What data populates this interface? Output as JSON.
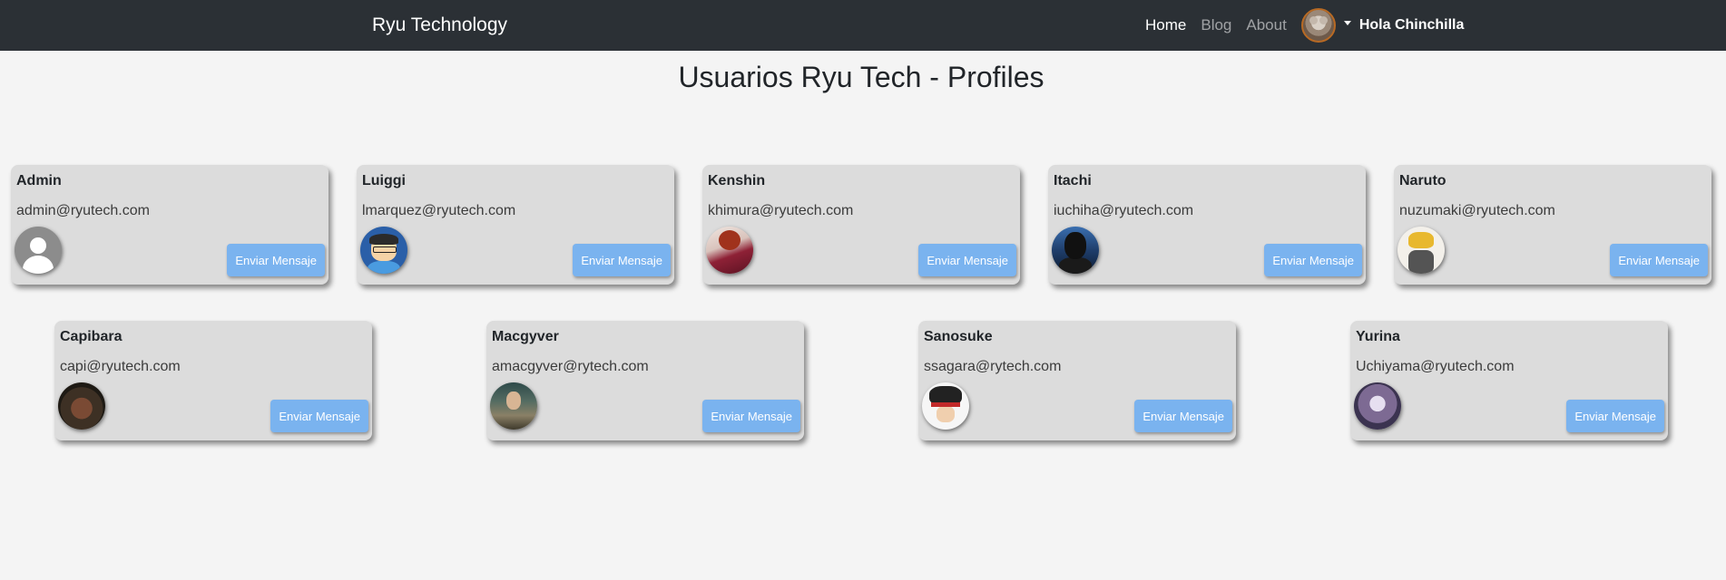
{
  "navbar": {
    "brand": "Ryu Technology",
    "links": [
      {
        "label": "Home",
        "active": true
      },
      {
        "label": "Blog",
        "active": false
      },
      {
        "label": "About",
        "active": false
      }
    ],
    "user_avatar_icon": "hamster-avatar",
    "greeting": "Hola Chinchilla"
  },
  "page": {
    "title": "Usuarios Ryu Tech - Profiles"
  },
  "profiles": [
    {
      "name": "Admin",
      "email": "admin@ryutech.com",
      "avatar": "default-user-avatar",
      "button_label": "Enviar Mensaje"
    },
    {
      "name": "Luiggi",
      "email": "lmarquez@ryutech.com",
      "avatar": "cartoon-boy-avatar",
      "button_label": "Enviar Mensaje"
    },
    {
      "name": "Kenshin",
      "email": "khimura@ryutech.com",
      "avatar": "kenshin-avatar",
      "button_label": "Enviar Mensaje"
    },
    {
      "name": "Itachi",
      "email": "iuchiha@ryutech.com",
      "avatar": "itachi-avatar",
      "button_label": "Enviar Mensaje"
    },
    {
      "name": "Naruto",
      "email": "nuzumaki@ryutech.com",
      "avatar": "naruto-avatar",
      "button_label": "Enviar Mensaje"
    },
    {
      "name": "Capibara",
      "email": "capi@ryutech.com",
      "avatar": "capybara-avatar",
      "button_label": "Enviar Mensaje"
    },
    {
      "name": "Macgyver",
      "email": "amacgyver@rytech.com",
      "avatar": "macgyver-avatar",
      "button_label": "Enviar Mensaje"
    },
    {
      "name": "Sanosuke",
      "email": "ssagara@rytech.com",
      "avatar": "sanosuke-avatar",
      "button_label": "Enviar Mensaje"
    },
    {
      "name": "Yurina",
      "email": "Uchiyama@ryutech.com",
      "avatar": "yurina-avatar",
      "button_label": "Enviar Mensaje"
    }
  ],
  "colors": {
    "navbar_bg": "#2b3035",
    "page_bg": "#f4f4f4",
    "card_bg": "#dcdcdc",
    "button_bg": "#7ab3ef"
  }
}
